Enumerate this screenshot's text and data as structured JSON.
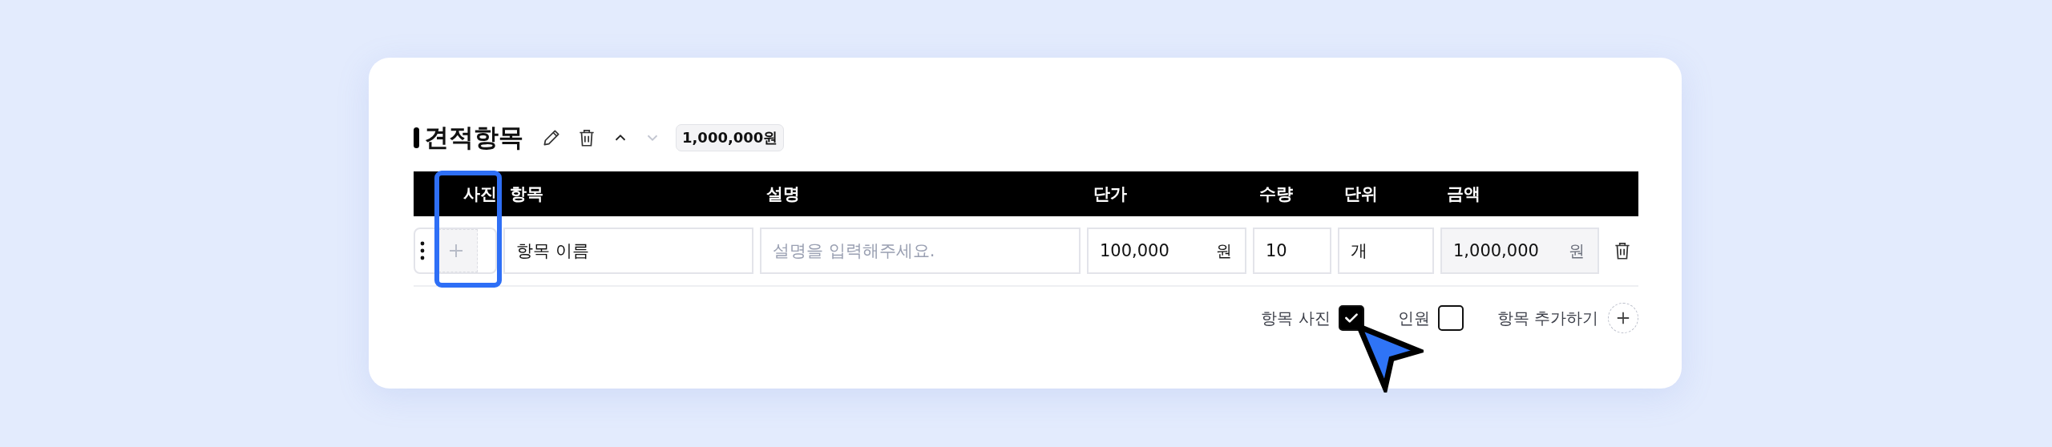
{
  "section": {
    "title": "견적항목",
    "total": "1,000,000원",
    "move_up": {
      "disabled": false
    },
    "move_down": {
      "disabled": true
    }
  },
  "columns": [
    "사진",
    "항목",
    "설명",
    "단가",
    "수량",
    "단위",
    "금액"
  ],
  "rows": [
    {
      "photo_highlighted": true,
      "item_name": "항목 이름",
      "description_placeholder": "설명을 입력해주세요.",
      "unit_price": {
        "value": "100,000",
        "suffix": "원"
      },
      "quantity": "10",
      "unit": "개",
      "amount": {
        "value": "1,000,000",
        "suffix": "원",
        "readonly": true
      }
    }
  ],
  "footer": {
    "toggles": [
      {
        "label": "항목 사진",
        "checked": true
      },
      {
        "label": "인원",
        "checked": false
      }
    ],
    "add_label": "항목 추가하기"
  }
}
